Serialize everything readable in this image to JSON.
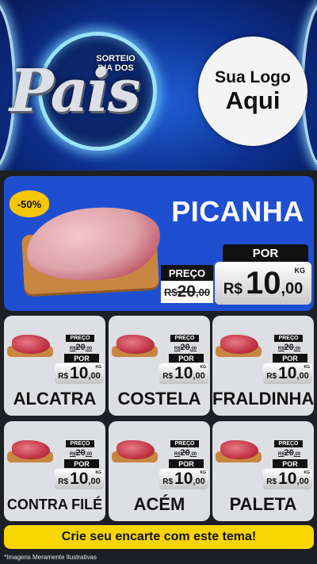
{
  "header": {
    "event_line1": "SORTEIO",
    "event_line2": "DIA DOS",
    "event_word": "Pais",
    "logo_line1": "Sua Logo",
    "logo_line2": "Aqui"
  },
  "featured": {
    "discount": "-50%",
    "name": "PICANHA",
    "preco_label": "PREÇO",
    "por_label": "POR",
    "old_prefix": "R$",
    "old_int": "20",
    "old_dec": ",00",
    "currency": "R$",
    "new_int": "10",
    "new_dec": ",00",
    "unit": "KG"
  },
  "products": [
    {
      "name": "ALCATRA",
      "preco_label": "PREÇO",
      "por_label": "POR",
      "old_prefix": "R$",
      "old_int": "20",
      "old_dec": ",00",
      "currency": "R$",
      "new_int": "10",
      "new_dec": ",00",
      "unit": "KG"
    },
    {
      "name": "COSTELA",
      "preco_label": "PREÇO",
      "por_label": "POR",
      "old_prefix": "R$",
      "old_int": "20",
      "old_dec": ",00",
      "currency": "R$",
      "new_int": "10",
      "new_dec": ",00",
      "unit": "KG"
    },
    {
      "name": "FRALDINHA",
      "preco_label": "PREÇO",
      "por_label": "POR",
      "old_prefix": "R$",
      "old_int": "20",
      "old_dec": ",00",
      "currency": "R$",
      "new_int": "10",
      "new_dec": ",00",
      "unit": "KG"
    },
    {
      "name": "CONTRA FILÉ",
      "preco_label": "PREÇO",
      "por_label": "POR",
      "old_prefix": "R$",
      "old_int": "20",
      "old_dec": ",00",
      "currency": "R$",
      "new_int": "10",
      "new_dec": ",00",
      "unit": "KG"
    },
    {
      "name": "ACÉM",
      "preco_label": "PREÇO",
      "por_label": "POR",
      "old_prefix": "R$",
      "old_int": "20",
      "old_dec": ",00",
      "currency": "R$",
      "new_int": "10",
      "new_dec": ",00",
      "unit": "KG"
    },
    {
      "name": "PALETA",
      "preco_label": "PREÇO",
      "por_label": "POR",
      "old_prefix": "R$",
      "old_int": "20",
      "old_dec": ",00",
      "currency": "R$",
      "new_int": "10",
      "new_dec": ",00",
      "unit": "KG"
    }
  ],
  "cta": "Crie seu encarte com este tema!",
  "footnote": "*Imagens Meramente Ilustrativas",
  "colors": {
    "header_blue": "#0d2f8e",
    "featured_blue": "#1f4fd1",
    "card_gray": "#dedfe2",
    "cta_yellow": "#f8d500",
    "discount_yellow": "#f7c600"
  }
}
